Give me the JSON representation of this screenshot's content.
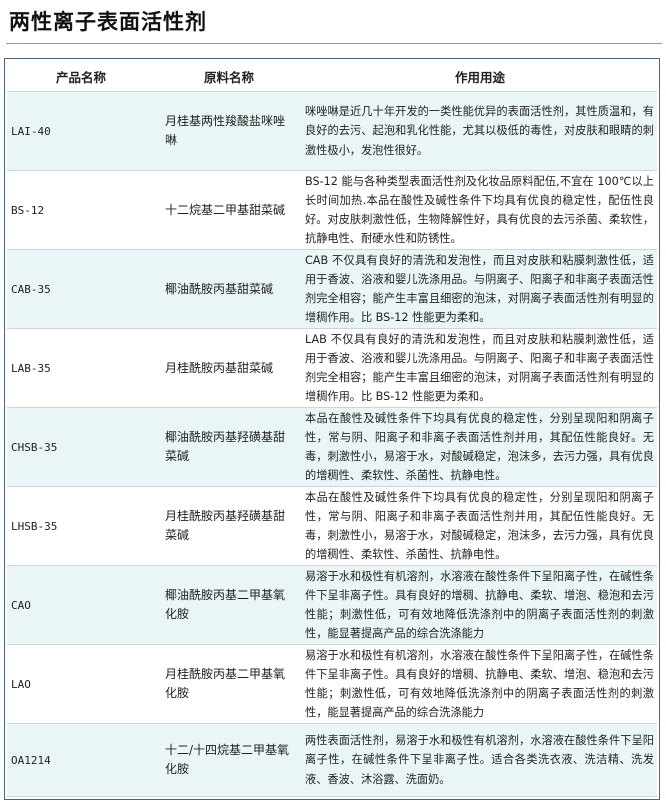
{
  "page": {
    "title": "两性离子表面活性剂"
  },
  "table": {
    "headers": [
      "产品名称",
      "原料名称",
      "作用用途"
    ],
    "rows": [
      {
        "code": "LAI-40",
        "material": "月桂基两性羧酸盐咪唑啉",
        "usage": "咪唑啉是近几十年开发的一类性能优异的表面活性剂，其性质温和，有良好的去污、起泡和乳化性能，尤其以极低的毒性，对皮肤和眼睛的刺激性极小，发泡性很好。"
      },
      {
        "code": "BS-12",
        "material": "十二烷基二甲基甜菜碱",
        "usage": "BS-12 能与各种类型表面活性剂及化妆品原料配伍,不宜在 100℃以上长时间加热.本品在酸性及碱性条件下均具有优良的稳定性，配伍性良好。对皮肤刺激性低，生物降解性好，具有优良的去污杀菌、柔软性，抗静电性、耐硬水性和防锈性。"
      },
      {
        "code": "CAB-35",
        "material": "椰油酰胺丙基甜菜碱",
        "usage": "CAB 不仅具有良好的清洗和发泡性，而且对皮肤和粘膜刺激性低，适用于香波、浴液和婴儿洗涤用品。与阴离子、阳离子和非离子表面活性剂完全相容；能产生丰富且细密的泡沫，对阴离子表面活性剂有明显的增稠作用。比 BS-12 性能更为柔和。"
      },
      {
        "code": "LAB-35",
        "material": "月桂酰胺丙基甜菜碱",
        "usage": "LAB 不仅具有良好的清洗和发泡性，而且对皮肤和粘膜刺激性低，适用于香波、浴液和婴儿洗涤用品。与阴离子、阳离子和非离子表面活性剂完全相容；能产生丰富且细密的泡沫，对阴离子表面活性剂有明显的增稠作用。比 BS-12 性能更为柔和。"
      },
      {
        "code": "CHSB-35",
        "material": "椰油酰胺丙基羟磺基甜菜碱",
        "usage": "本品在酸性及碱性条件下均具有优良的稳定性，分别呈现阳和阴离子性，常与阴、阳离子和非离子表面活性剂并用，其配伍性能良好。无毒，刺激性小，易溶于水，对酸碱稳定，泡沫多，去污力强，具有优良的增稠性、柔软性、杀菌性、抗静电性。"
      },
      {
        "code": "LHSB-35",
        "material": "月桂酰胺丙基羟磺基甜菜碱",
        "usage": "本品在酸性及碱性条件下均具有优良的稳定性，分别呈现阳和阴离子性，常与阴、阳离子和非离子表面活性剂并用，其配伍性能良好。无毒，刺激性小，易溶于水，对酸碱稳定，泡沫多，去污力强，具有优良的增稠性、柔软性、杀菌性、抗静电性。"
      },
      {
        "code": "CAO",
        "material": "椰油酰胺丙基二甲基氧化胺",
        "usage": "易溶于水和极性有机溶剂，水溶液在酸性条件下呈阳离子性，在碱性条件下呈非离子性。具有良好的增稠、抗静电、柔软、增泡、稳泡和去污性能；刺激性低，可有效地降低洗涤剂中的阴离子表面活性剂的刺激性，能显著提高产品的综合洗涤能力"
      },
      {
        "code": "LAO",
        "material": "月桂酰胺丙基二甲基氧化胺",
        "usage": "易溶于水和极性有机溶剂，水溶液在酸性条件下呈阳离子性，在碱性条件下呈非离子性。具有良好的增稠、抗静电、柔软、增泡、稳泡和去污性能；刺激性低，可有效地降低洗涤剂中的阴离子表面活性剂的刺激性，能显著提高产品的综合洗涤能力"
      },
      {
        "code": "OA1214",
        "material": "十二/十四烷基二甲基氧化胺",
        "usage": "两性表面活性剂，易溶于水和极性有机溶剂，水溶液在酸性条件下呈阳离子性，在碱性条件下呈非离子性。适合各类洗衣液、洗洁精、洗发液、香波、沐浴露、洗面奶。"
      }
    ]
  },
  "colors": {
    "row_alt_background": "#eaf6f6",
    "row_plain_background": "#ffffff",
    "frame_border": "#4f6478",
    "row_divider": "#c9d6de"
  }
}
